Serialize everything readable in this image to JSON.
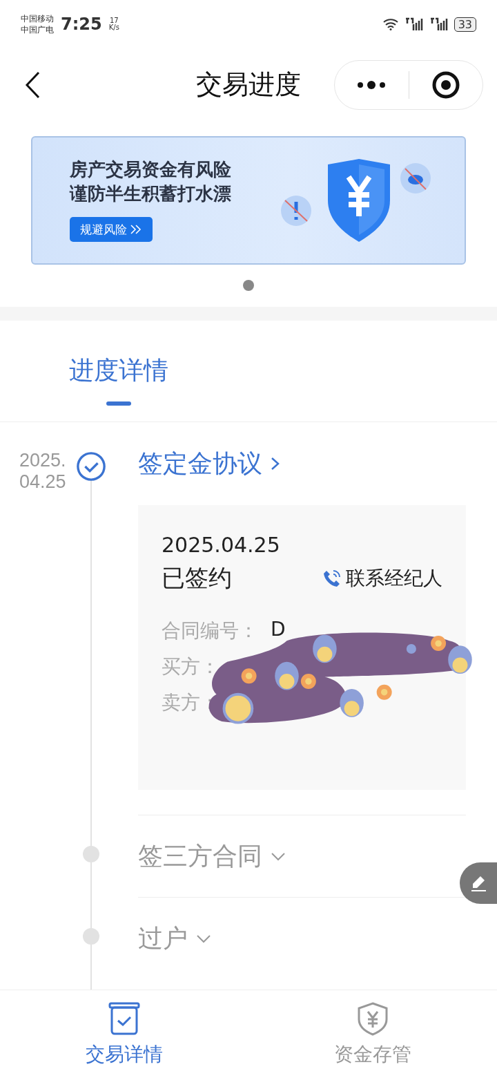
{
  "status_bar": {
    "carriers": [
      "中国移动",
      "中国广电"
    ],
    "time": "7:25",
    "speed_value": "17",
    "speed_unit": "K/s",
    "battery": "33"
  },
  "nav": {
    "title": "交易进度"
  },
  "banner": {
    "lines": [
      "房产交易资金有风险",
      "谨防半生积蓄打水漂"
    ],
    "button": "规避风险",
    "pager": [
      {
        "selected": true
      }
    ]
  },
  "tabs": [
    {
      "label": "进度详情",
      "selected": true
    }
  ],
  "timeline": [
    {
      "title": "签定金协议",
      "date": "2025.04.25",
      "done": true,
      "expanded": true,
      "card": {
        "date": "2025.04.25",
        "status": "已签约",
        "contact": "联系经纪人",
        "fields": [
          {
            "label": "合同编号：",
            "value": "D"
          },
          {
            "label": "买方："
          },
          {
            "label": "卖方："
          }
        ]
      }
    },
    {
      "title": "签三方合同",
      "done": false,
      "expanded": false
    },
    {
      "title": "过户",
      "done": false,
      "expanded": false
    }
  ],
  "bottom_tabs": [
    {
      "label": "交易详情",
      "kind": "details",
      "selected": true
    },
    {
      "label": "资金存管",
      "kind": "funds",
      "selected": false
    }
  ]
}
